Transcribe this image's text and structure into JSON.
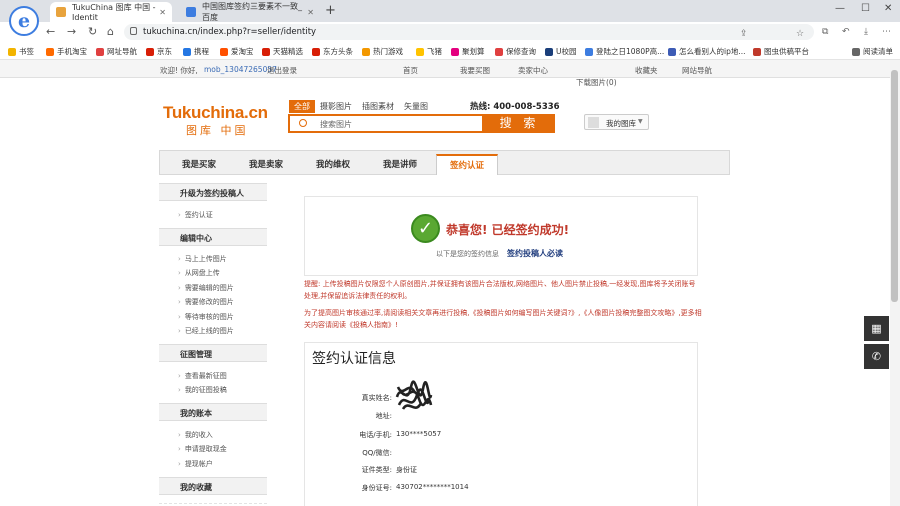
{
  "browser": {
    "tabs": [
      {
        "title": "TukuChina 图库 中国 - Identit",
        "close": "✕"
      },
      {
        "title": "中国图库签约三要素不一致_百度",
        "close": "✕"
      }
    ],
    "new_tab": "+",
    "url": "tukuchina.cn/index.php?r=seller/identity",
    "nav": {
      "back": "←",
      "forward": "→",
      "reload": "↻"
    },
    "bookmarks": [
      {
        "label": "书签",
        "color": "#f2b400"
      },
      {
        "label": "手机淘宝",
        "color": "#ff6a00"
      },
      {
        "label": "网址导航",
        "color": "#e04040"
      },
      {
        "label": "京东",
        "color": "#d81e06"
      },
      {
        "label": "携程",
        "color": "#2577e3"
      },
      {
        "label": "爱淘宝",
        "color": "#ff5000"
      },
      {
        "label": "天猫精选",
        "color": "#d81e06"
      },
      {
        "label": "东方头条",
        "color": "#d81e06"
      },
      {
        "label": "热门游戏",
        "color": "#f39800"
      },
      {
        "label": "飞猪",
        "color": "#ffc300"
      },
      {
        "label": "聚划算",
        "color": "#e4007f"
      },
      {
        "label": "保修查询",
        "color": "#e04040"
      },
      {
        "label": "U校园",
        "color": "#1a3e7a"
      },
      {
        "label": "登陆之日1080P高...",
        "color": "#3d7de0"
      },
      {
        "label": "怎么看别人的ip地...",
        "color": "#3d5bb5"
      },
      {
        "label": "图虫供稿平台",
        "color": "#c0392b"
      },
      {
        "label": "阅读清单",
        "color": "#666666"
      }
    ]
  },
  "site": {
    "topbar": {
      "welcome": "欢迎! 你好,",
      "username": "mob_13047265057",
      "logout": "退出登录",
      "links": [
        "首页",
        "我要买图",
        "卖家中心",
        "收藏夹",
        "网站导航"
      ],
      "cart": "下载图片(0)"
    },
    "logo_en": "Tukuchina.cn",
    "logo_cn": "图库 中国",
    "search_tabs": [
      "全部",
      "摄影图片",
      "插图素材",
      "矢量图"
    ],
    "hotline": "热线: 400-008-5336",
    "search_placeholder": "搜索图片",
    "search_button": "搜 索",
    "my_gallery": "我的图库",
    "main_nav": [
      "我是买家",
      "我是卖家",
      "我的维权",
      "我是讲师",
      "签约认证"
    ]
  },
  "sidebar": {
    "sections": [
      {
        "title": "升级为签约投稿人",
        "items": [
          "签约认证"
        ]
      },
      {
        "title": "编辑中心",
        "items": [
          "马上上传图片",
          "从网盘上传",
          "需要编辑的图片",
          "需要修改的图片",
          "等待审核的图片",
          "已经上线的图片"
        ]
      },
      {
        "title": "征图管理",
        "items": [
          "查看最新征图",
          "我的征图投稿"
        ]
      },
      {
        "title": "我的账本",
        "items": [
          "我的收入",
          "申请提取现金",
          "提现帐户"
        ]
      },
      {
        "title": "我的收藏",
        "items": []
      }
    ]
  },
  "success": {
    "title": "恭喜您! 已经签约成功!",
    "subtitle": "以下是您的签约信息",
    "link": "签约投稿人必读"
  },
  "notice": "提醒: 上传投稿图片仅限您个人原创图片,并保证拥有该图片合法版权,网络图片、他人图片禁止投稿,一经发现,图库将予关闭账号处理,并保留追诉法律责任的权利。",
  "tip": "为了提高图片审核通过率,请阅读相关文章再进行投稿,《投稿图片如何编写图片关键词?》,《人像图片投稿完整图文攻略》,更多相关内容请阅读《投稿人指南》!",
  "info": {
    "title": "签约认证信息",
    "fields": [
      {
        "label": "真实姓名:",
        "value": ""
      },
      {
        "label": "地址:",
        "value": ""
      },
      {
        "label": "电话/手机:",
        "value": "130****5057"
      },
      {
        "label": "QQ/微信:",
        "value": ""
      },
      {
        "label": "证件类型:",
        "value": "身份证"
      },
      {
        "label": "身份证号:",
        "value": "430702********1014"
      }
    ]
  }
}
